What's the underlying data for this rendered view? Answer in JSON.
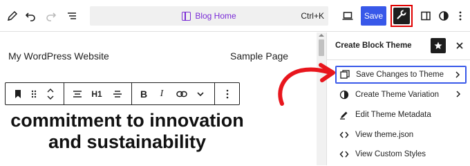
{
  "topbar": {
    "command_title": "Blog Home",
    "command_shortcut": "Ctrl+K",
    "save_label": "Save"
  },
  "canvas": {
    "site_title": "My WordPress Website",
    "nav_link": "Sample Page",
    "block_toolbar": {
      "heading_level": "H1",
      "bold": "B",
      "italic": "I"
    },
    "heading_text": "commitment to innovation and sustainability"
  },
  "sidebar": {
    "title": "Create Block Theme",
    "items": [
      {
        "label": "Save Changes to Theme",
        "icon": "save-icon",
        "has_chevron": true
      },
      {
        "label": "Create Theme Variation",
        "icon": "styles-icon",
        "has_chevron": true
      },
      {
        "label": "Edit Theme Metadata",
        "icon": "pencil-icon",
        "has_chevron": false
      },
      {
        "label": "View theme.json",
        "icon": "code-icon",
        "has_chevron": false
      },
      {
        "label": "View Custom Styles",
        "icon": "code-icon",
        "has_chevron": false
      }
    ]
  },
  "colors": {
    "accent": "#3858e9",
    "command_title": "#7a2bd6",
    "highlight_box": "#e00000",
    "annotation_arrow": "#e8161d"
  }
}
